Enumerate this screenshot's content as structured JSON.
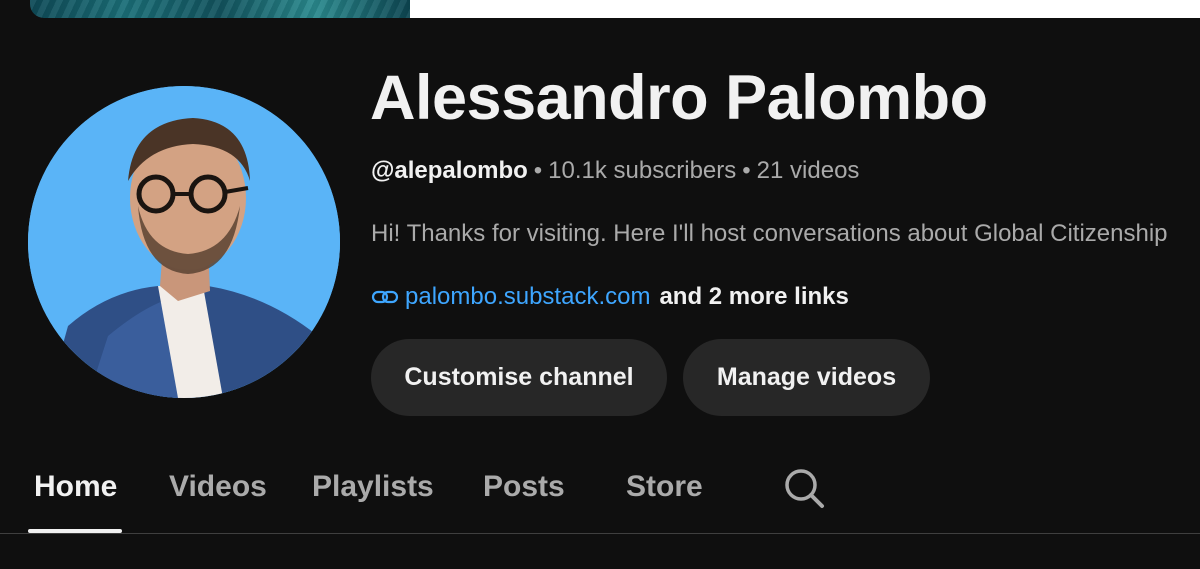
{
  "channel": {
    "name": "Alessandro Palombo",
    "handle": "@alepalombo",
    "subscribers": "10.1k subscribers",
    "videos": "21 videos",
    "separator": "•",
    "description": "Hi! Thanks for visiting. Here I'll host conversations about Global Citizenship",
    "link_url": "palombo.substack.com",
    "more_links": "and 2 more links"
  },
  "buttons": {
    "customise_label": "Customise channel",
    "manage_label": "Manage videos"
  },
  "tabs": [
    {
      "label": "Home",
      "active": true
    },
    {
      "label": "Videos",
      "active": false
    },
    {
      "label": "Playlists",
      "active": false
    },
    {
      "label": "Posts",
      "active": false
    },
    {
      "label": "Store",
      "active": false
    }
  ],
  "icons": {
    "link": "link-icon",
    "search": "search-icon"
  },
  "colors": {
    "background": "#0f0f0f",
    "avatar_background": "#5ab4f7",
    "link": "#3ea6ff",
    "button_background": "#272727",
    "secondary_text": "#aaaaaa"
  }
}
